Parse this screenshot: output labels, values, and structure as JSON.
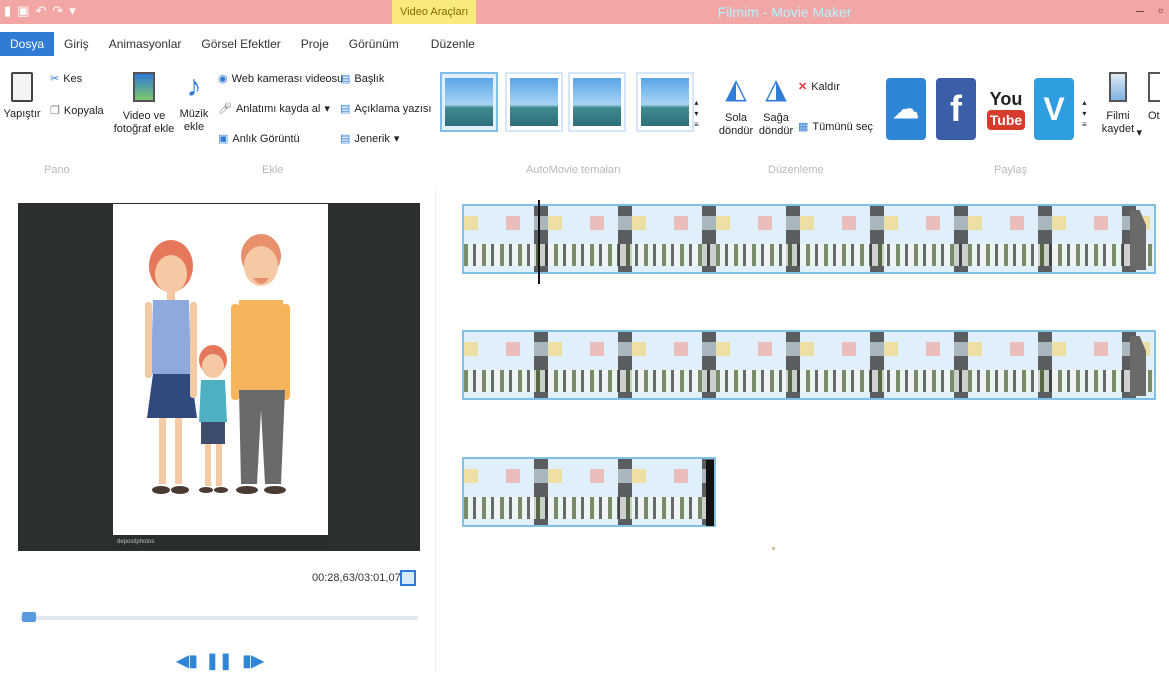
{
  "titlebar": {
    "context_tab": "Video Araçları",
    "title": "Filmim - Movie Maker"
  },
  "menu": [
    "Dosya",
    "Giriş",
    "Animasyonlar",
    "Görsel Efektler",
    "Proje",
    "Görünüm",
    "Düzenle"
  ],
  "ribbon": {
    "pano": {
      "paste": "Yapıştır",
      "cut": "Kes",
      "copy": "Kopyala",
      "label": "Pano"
    },
    "ekle": {
      "video_photo": "Video ve fotoğraf ekle",
      "music": "Müzik ekle",
      "webcam": "Web kamerası videosu",
      "narration": "Anlatımı kayda al",
      "snapshot": "Anlık Görüntü",
      "title": "Başlık",
      "caption": "Açıklama yazısı",
      "credits": "Jenerik",
      "label": "Ekle"
    },
    "themes": {
      "label": "AutoMovie temaları"
    },
    "duzenleme": {
      "rotate_left": "Sola döndür",
      "rotate_right": "Sağa döndür",
      "remove": "Kaldır",
      "select_all": "Tümünü seç",
      "label": "Düzenleme"
    },
    "paylas": {
      "youtube_top": "You",
      "youtube_bottom": "Tube",
      "facebook": "f",
      "vimeo": "V",
      "label": "Paylaş"
    },
    "save_movie": "Filmi kaydet",
    "cut_off": "Ot"
  },
  "preview": {
    "frame_footer": "depositphotos",
    "timecode": "00:28,63/03:01,07"
  }
}
